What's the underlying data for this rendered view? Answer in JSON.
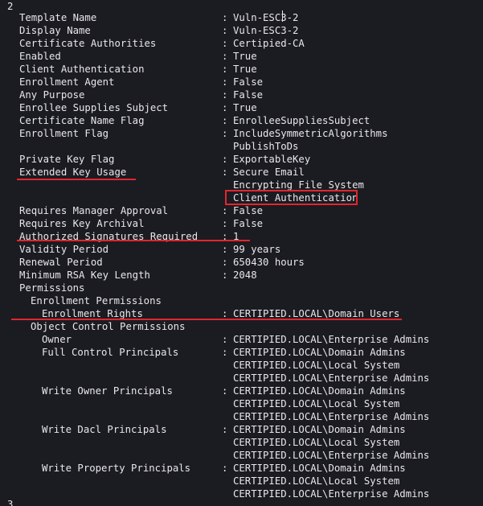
{
  "top_index": "2",
  "bottom_index": "3",
  "rows": [
    {
      "k": "Template Name",
      "v": "Vuln-ESC3-2"
    },
    {
      "k": "Display Name",
      "v": "Vuln-ESC3-2"
    },
    {
      "k": "Certificate Authorities",
      "v": "Certipied-CA"
    },
    {
      "k": "Enabled",
      "v": "True"
    },
    {
      "k": "Client Authentication",
      "v": "True"
    },
    {
      "k": "Enrollment Agent",
      "v": "False"
    },
    {
      "k": "Any Purpose",
      "v": "False"
    },
    {
      "k": "Enrollee Supplies Subject",
      "v": "True"
    },
    {
      "k": "Certificate Name Flag",
      "v": "EnrolleeSuppliesSubject"
    },
    {
      "k": "Enrollment Flag",
      "v": "IncludeSymmetricAlgorithms"
    },
    {
      "k": "",
      "v": "PublishToDs"
    },
    {
      "k": "Private Key Flag",
      "v": "ExportableKey"
    },
    {
      "k": "Extended Key Usage",
      "v": "Secure Email"
    },
    {
      "k": "",
      "v": "Encrypting File System"
    },
    {
      "k": "",
      "v": "Client Authentication"
    },
    {
      "k": "Requires Manager Approval",
      "v": "False"
    },
    {
      "k": "Requires Key Archival",
      "v": "False"
    },
    {
      "k": "Authorized Signatures Required",
      "v": "1"
    },
    {
      "k": "Validity Period",
      "v": "99 years"
    },
    {
      "k": "Renewal Period",
      "v": "650430 hours"
    },
    {
      "k": "Minimum RSA Key Length",
      "v": "2048"
    },
    {
      "k": "Permissions",
      "v": ""
    },
    {
      "k": "Enrollment Permissions",
      "v": ""
    },
    {
      "k": "Enrollment Rights",
      "v": "CERTIPIED.LOCAL\\Domain Users"
    },
    {
      "k": "Object Control Permissions",
      "v": ""
    },
    {
      "k": "Owner",
      "v": "CERTIPIED.LOCAL\\Enterprise Admins"
    },
    {
      "k": "Full Control Principals",
      "v": "CERTIPIED.LOCAL\\Domain Admins"
    },
    {
      "k": "",
      "v": "CERTIPIED.LOCAL\\Local System"
    },
    {
      "k": "",
      "v": "CERTIPIED.LOCAL\\Enterprise Admins"
    },
    {
      "k": "Write Owner Principals",
      "v": "CERTIPIED.LOCAL\\Domain Admins"
    },
    {
      "k": "",
      "v": "CERTIPIED.LOCAL\\Local System"
    },
    {
      "k": "",
      "v": "CERTIPIED.LOCAL\\Enterprise Admins"
    },
    {
      "k": "Write Dacl Principals",
      "v": "CERTIPIED.LOCAL\\Domain Admins"
    },
    {
      "k": "",
      "v": "CERTIPIED.LOCAL\\Local System"
    },
    {
      "k": "",
      "v": "CERTIPIED.LOCAL\\Enterprise Admins"
    },
    {
      "k": "Write Property Principals",
      "v": "CERTIPIED.LOCAL\\Domain Admins"
    },
    {
      "k": "",
      "v": "CERTIPIED.LOCAL\\Local System"
    },
    {
      "k": "",
      "v": "CERTIPIED.LOCAL\\Enterprise Admins"
    }
  ],
  "colors": {
    "background": "#1b1b22",
    "text": "#e8e8ea",
    "highlight": "#e3262d"
  }
}
